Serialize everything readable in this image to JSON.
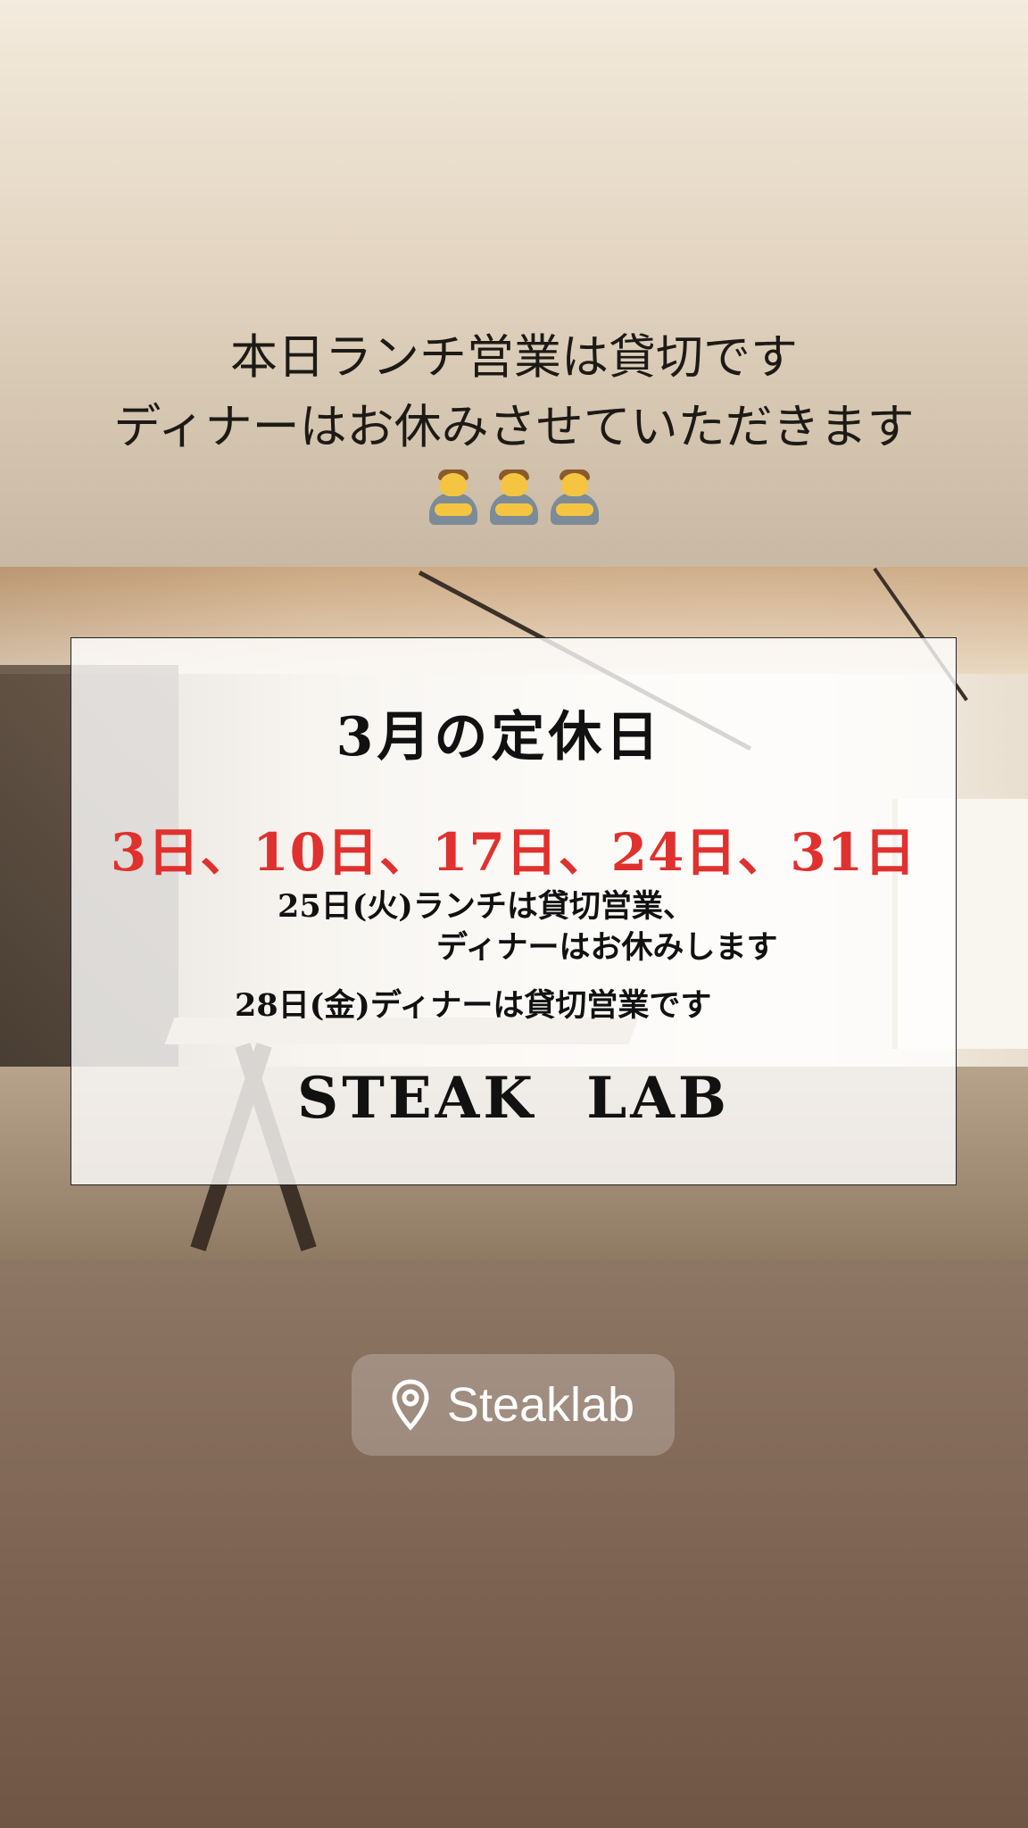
{
  "story": {
    "caption_line1": "本日ランチ営業は貸切です",
    "caption_line2": "ディナーはお休みさせていただきます",
    "emoji_name": "person-bowing-icon",
    "emoji_count": 3
  },
  "notice": {
    "title": "3月の定休日",
    "dates": "3日、10日、17日、24日、31日",
    "note_line1": "25日(火)ランチは貸切営業、",
    "note_line2": "ディナーはお休みします",
    "note_line3": "28日(金)ディナーは貸切営業です",
    "brand": "STEAK LAB",
    "dates_color": "#e0312e"
  },
  "location": {
    "icon": "location-pin-icon",
    "label": "Steaklab"
  }
}
